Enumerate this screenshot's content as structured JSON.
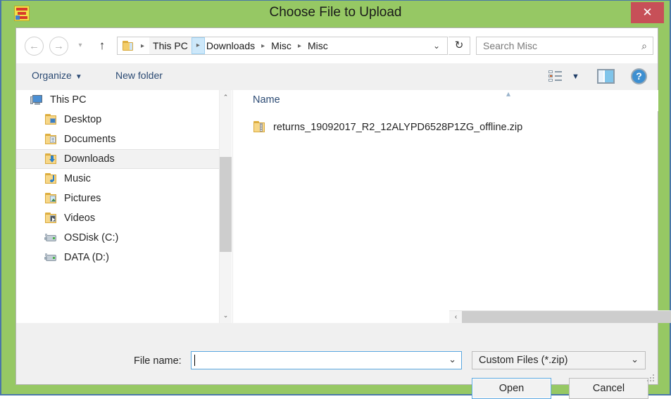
{
  "window": {
    "title": "Choose File to Upload",
    "app_icon": "application-icon",
    "close_label": "✕",
    "frame_color": "#96c864",
    "close_button_color": "#c75058"
  },
  "address_bar": {
    "back_label": "←",
    "forward_label": "→",
    "recent_label": "▾",
    "up_label": "↑",
    "crumbs": [
      {
        "label": "This PC"
      },
      {
        "label": "Downloads"
      },
      {
        "label": "Misc"
      },
      {
        "label": "Misc"
      }
    ],
    "separator": "▸",
    "dropdown_caret": "⌄",
    "refresh_label": "↻"
  },
  "search": {
    "placeholder": "Search Misc",
    "icon": "search-icon",
    "icon_glyph": "⌕"
  },
  "toolbar": {
    "organize_label": "Organize",
    "organize_caret": "▼",
    "new_folder_label": "New folder",
    "view_caret": "▼",
    "help_label": "?"
  },
  "nav_pane": {
    "items": [
      {
        "label": "This PC",
        "icon": "computer-icon",
        "level": 0,
        "selected": false
      },
      {
        "label": "Desktop",
        "icon": "folder-desktop-icon",
        "level": 1,
        "selected": false
      },
      {
        "label": "Documents",
        "icon": "folder-documents-icon",
        "level": 1,
        "selected": false
      },
      {
        "label": "Downloads",
        "icon": "folder-downloads-icon",
        "level": 1,
        "selected": true
      },
      {
        "label": "Music",
        "icon": "folder-music-icon",
        "level": 1,
        "selected": false
      },
      {
        "label": "Pictures",
        "icon": "folder-pictures-icon",
        "level": 1,
        "selected": false
      },
      {
        "label": "Videos",
        "icon": "folder-videos-icon",
        "level": 1,
        "selected": false
      },
      {
        "label": "OSDisk (C:)",
        "icon": "drive-icon",
        "level": 1,
        "selected": false
      },
      {
        "label": "DATA (D:)",
        "icon": "drive-icon",
        "level": 1,
        "selected": false
      }
    ],
    "scroll_up": "⌃",
    "scroll_down": "⌄"
  },
  "file_list": {
    "column_header": "Name",
    "sort_caret": "▴",
    "files": [
      {
        "name": "returns_19092017_R2_12ALYPD6528P1ZG_offline.zip",
        "icon": "zip-file-icon"
      }
    ],
    "hscroll_left": "‹",
    "hscroll_right": "›"
  },
  "footer": {
    "file_name_label": "File name:",
    "file_name_value": "",
    "file_name_caret": "⌄",
    "file_type_value": "Custom Files (*.zip)",
    "file_type_caret": "⌄",
    "open_label": "Open",
    "cancel_label": "Cancel"
  }
}
